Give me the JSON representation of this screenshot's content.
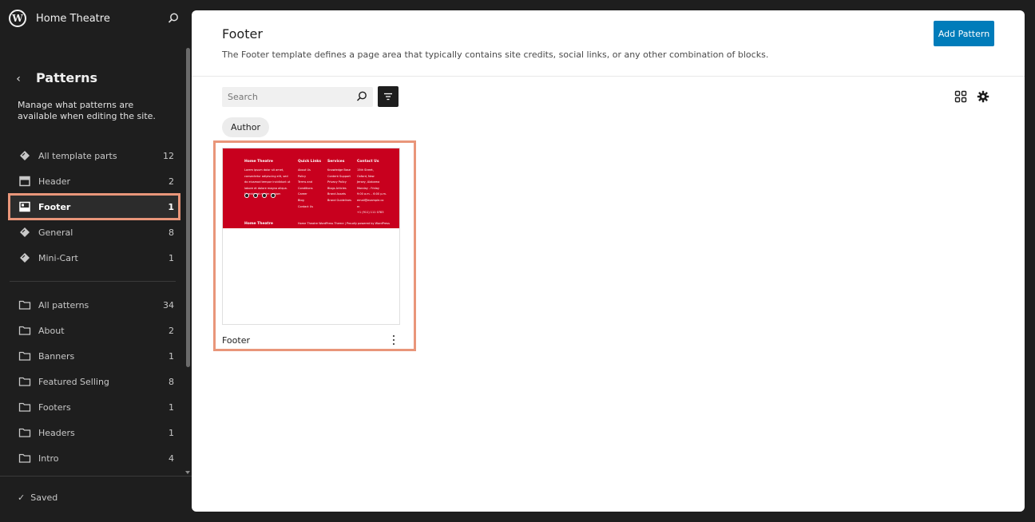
{
  "site": {
    "title": "Home Theatre"
  },
  "sidebar": {
    "title": "Patterns",
    "description": "Manage what patterns are available when editing the site.",
    "template_parts": [
      {
        "label": "All template parts",
        "count": "12",
        "icon": "symbol-icon"
      },
      {
        "label": "Header",
        "count": "2",
        "icon": "header-icon"
      },
      {
        "label": "Footer",
        "count": "1",
        "icon": "footer-icon",
        "active": true
      },
      {
        "label": "General",
        "count": "8",
        "icon": "symbol-icon"
      },
      {
        "label": "Mini-Cart",
        "count": "1",
        "icon": "symbol-icon"
      }
    ],
    "categories": [
      {
        "label": "All patterns",
        "count": "34"
      },
      {
        "label": "About",
        "count": "2"
      },
      {
        "label": "Banners",
        "count": "1"
      },
      {
        "label": "Featured Selling",
        "count": "8"
      },
      {
        "label": "Footers",
        "count": "1"
      },
      {
        "label": "Headers",
        "count": "1"
      },
      {
        "label": "Intro",
        "count": "4"
      }
    ],
    "status": "Saved"
  },
  "main": {
    "title": "Footer",
    "description": "The Footer template defines a page area that typically contains site credits, social links, or any other combination of blocks.",
    "add_button": "Add Pattern",
    "search_placeholder": "Search",
    "chip": "Author",
    "card": {
      "title": "Footer",
      "preview": {
        "brand": "Home Theatre",
        "brand_text": [
          "Lorem ipsum dolor sit amet,",
          "consectetur adipiscing elit, sed",
          "do eiusmod tempor incididunt ut",
          "labore et dolore magna aliqua.",
          "Ut enim ad minim veniam"
        ],
        "quick_links_heading": "Quick Links",
        "quick_links": [
          "About Us",
          "Policy",
          "Terms and",
          "Conditions",
          "Career",
          "Blog",
          "Contact Us"
        ],
        "services_heading": "Services",
        "services": [
          "Knowledge Base",
          "Content Support",
          "Privacy Policy",
          "Blogs Articles",
          "Brand Assets",
          "Brand Guidelines"
        ],
        "contact_heading": "Contact Us",
        "contact": [
          "15th Street,",
          "Oxford, New",
          "Jersey, Alabama",
          "Monday - Friday",
          "9:00 a.m. - 6:00 p.m.",
          "email@example.co",
          "m",
          "+1 (911) 111 0783"
        ],
        "footer_brand": "Home Theatre",
        "footer_credit": "Home Theatre WordPress Theme | Proudly powered by WordPress"
      }
    }
  },
  "colors": {
    "accent": "#007cba",
    "highlight": "#e9967a",
    "preview_red": "#c8001e"
  }
}
